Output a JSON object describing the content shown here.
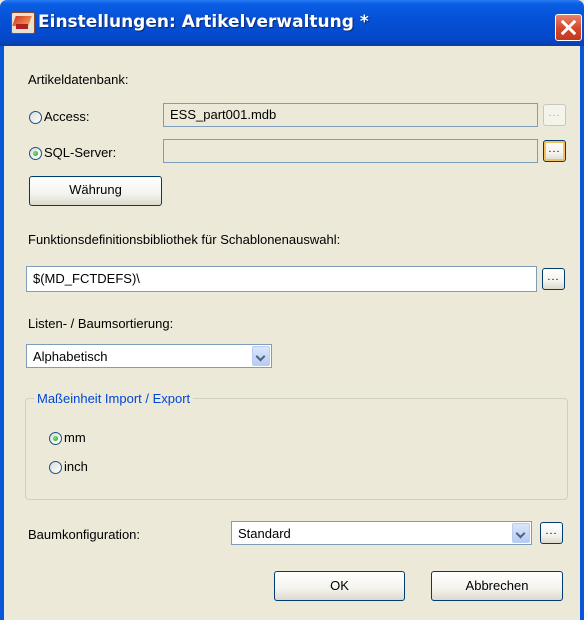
{
  "window": {
    "title": "Einstellungen: Artikelverwaltung *"
  },
  "database": {
    "section_label": "Artikeldatenbank:",
    "access_label": "Access:",
    "access_value": "ESS_part001.mdb",
    "sql_label": "SQL-Server:",
    "sql_value": "",
    "selected": "SQL-Server",
    "browse_label": "...",
    "currency_button": "Währung"
  },
  "function_library": {
    "label": "Funktionsdefinitionsbibliothek für Schablonenauswahl:",
    "value": "$(MD_FCTDEFS)\\",
    "browse_label": "..."
  },
  "sorting": {
    "label": "Listen- / Baumsortierung:",
    "selected": "Alphabetisch"
  },
  "units": {
    "group_title": "Maßeinheit Import / Export",
    "mm_label": "mm",
    "inch_label": "inch",
    "selected": "mm"
  },
  "tree": {
    "label": "Baumkonfiguration:",
    "selected": "Standard",
    "browse_label": "..."
  },
  "buttons": {
    "ok": "OK",
    "cancel": "Abbrechen"
  }
}
